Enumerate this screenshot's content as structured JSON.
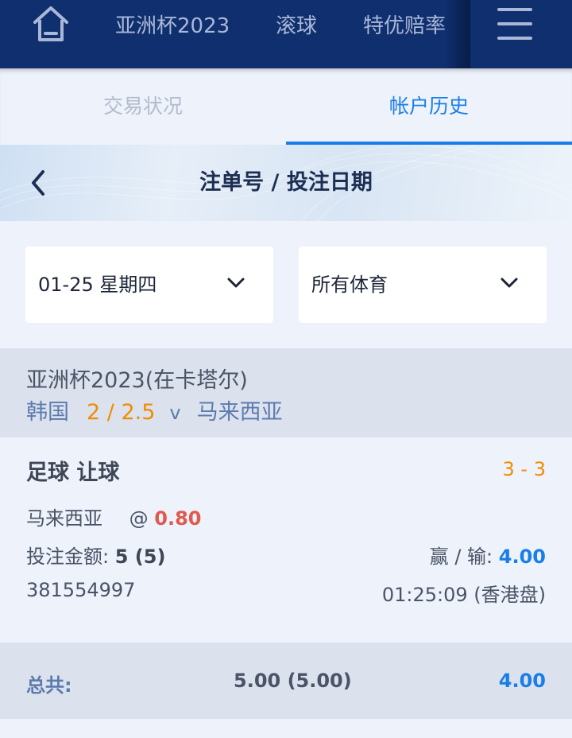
{
  "nav": {
    "items": [
      "亚洲杯2023",
      "滚球",
      "特优赔率"
    ],
    "icons": {
      "home": "home-icon",
      "menu": "hamburger-menu-icon"
    }
  },
  "tabs": [
    {
      "label": "交易状况",
      "active": false
    },
    {
      "label": "帐户历史",
      "active": true
    }
  ],
  "subheader": {
    "title": "注单号 / 投注日期"
  },
  "filters": {
    "date": "01-25 星期四",
    "sport": "所有体育"
  },
  "match": {
    "league": "亚洲杯2023(在卡塔尔)",
    "home": "韩国",
    "handicap": "2 / 2.5",
    "vs": "v",
    "away": "马来西亚"
  },
  "bet": {
    "type": "足球 让球",
    "score": "3 - 3",
    "selection": "马来西亚",
    "at": "@",
    "odds": "0.80",
    "stake_label": "投注金额:",
    "stake": "5 (5)",
    "winloss_label": "赢 / 输:",
    "winloss": "4.00",
    "ticket_id": "381554997",
    "time": "01:25:09 (香港盘)"
  },
  "total": {
    "label": "总共:",
    "stake": "5.00 (5.00)",
    "winloss": "4.00"
  },
  "colors": {
    "topbar": "#0f2f6e",
    "accent": "#1a7ee8",
    "orange": "#f08c00",
    "odds_red": "#e05a4e"
  }
}
